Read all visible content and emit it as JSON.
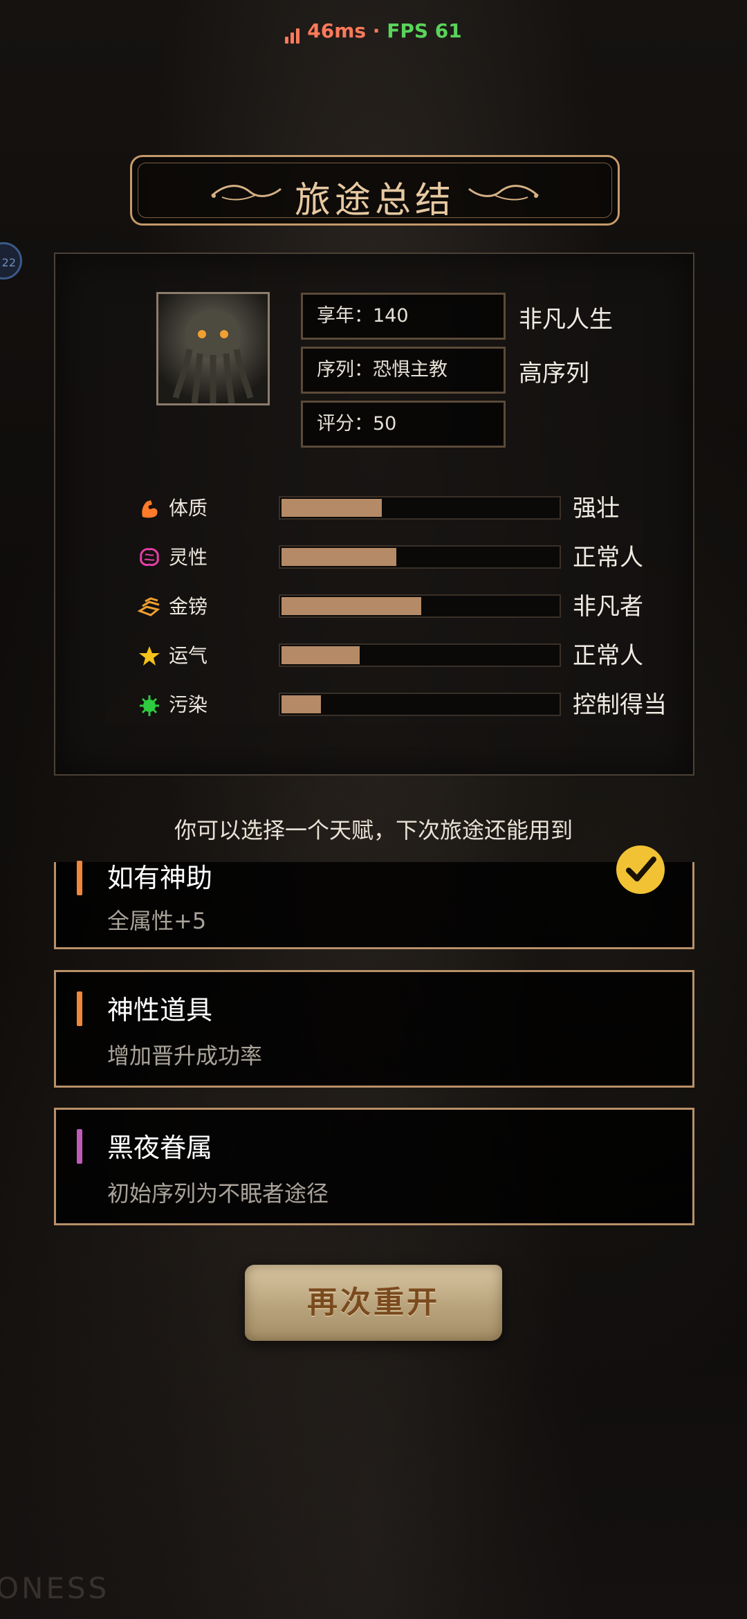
{
  "status": {
    "latency": "46ms",
    "separator": " · ",
    "fps": "FPS 61"
  },
  "side_bubble": {
    "label": "22"
  },
  "banner": {
    "title": "旅途总结"
  },
  "summary": {
    "age_label": "享年：140",
    "sequence_label": "序列：恐惧主教",
    "score_label": "评分：50",
    "life_rating": "非凡人生",
    "sequence_rating": "高序列"
  },
  "attributes": [
    {
      "name": "体质",
      "level": "强壮",
      "fraction": 0.37,
      "icon": "muscle-arm-icon",
      "color": "#ff7a2a"
    },
    {
      "name": "灵性",
      "level": "正常人",
      "fraction": 0.42,
      "icon": "brain-icon",
      "color": "#e63fa8"
    },
    {
      "name": "金镑",
      "level": "非凡者",
      "fraction": 0.51,
      "icon": "gold-bars-icon",
      "color": "#f0a030"
    },
    {
      "name": "运气",
      "level": "正常人",
      "fraction": 0.29,
      "icon": "star-icon",
      "color": "#f4c21a"
    },
    {
      "name": "污染",
      "level": "控制得当",
      "fraction": 0.15,
      "icon": "virus-icon",
      "color": "#2ecc40"
    }
  ],
  "hint": "你可以选择一个天赋，下次旅途还能用到",
  "talents": [
    {
      "name": "如有神助",
      "desc": "全属性+5",
      "mark_color": "#f0873a",
      "selected": true
    },
    {
      "name": "神性道具",
      "desc": "增加晋升成功率",
      "mark_color": "#f0873a",
      "selected": false
    },
    {
      "name": "黑夜眷属",
      "desc": "初始序列为不眠者途径",
      "mark_color": "#c05ab8",
      "selected": false
    }
  ],
  "restart_button": "再次重开",
  "watermark": "ONESS"
}
